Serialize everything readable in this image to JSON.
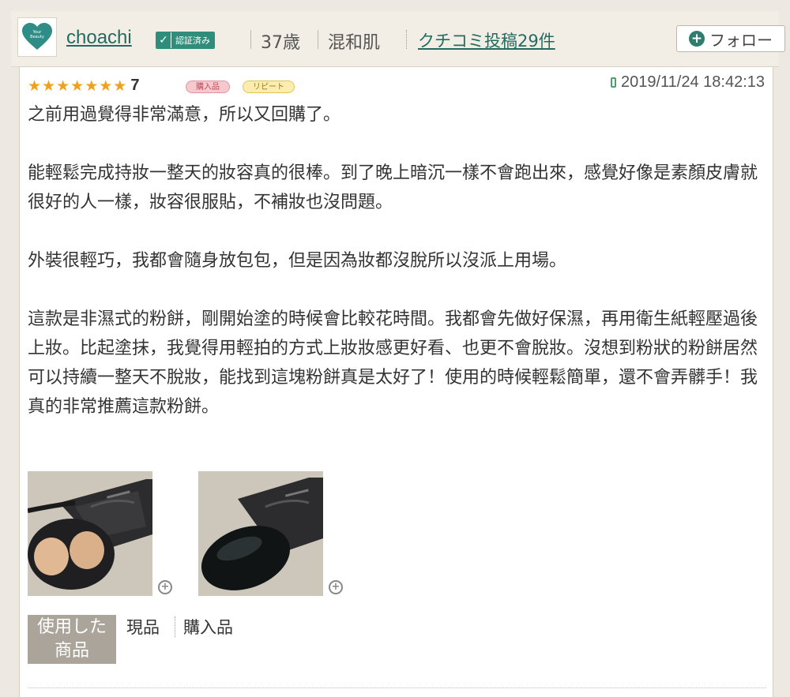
{
  "header": {
    "username": "choachi",
    "verified_label": "認証済み",
    "age": "37歳",
    "skin_type": "混和肌",
    "posts_link": "クチコミ投稿29件",
    "follow_label": "フォロー"
  },
  "review": {
    "rating": "7",
    "stars_filled": 7,
    "tag_purchase": "購入品",
    "tag_repeat": "リピート",
    "timestamp": "2019/11/24 18:42:13",
    "paragraphs": [
      "之前用過覺得非常滿意，所以又回購了。",
      "能輕鬆完成持妝一整天的妝容真的很棒。到了晚上暗沉一樣不會跑出來，感覺好像是素顏皮膚就很好的人一樣，妝容很服貼，不補妝也沒問題。",
      "外裝很輕巧，我都會隨身放包包，但是因為妝都沒脫所以沒派上用場。",
      "這款是非濕式的粉餅，剛開始塗的時候會比較花時間。我都會先做好保濕，再用衛生紙輕壓過後上妝。比起塗抹，我覺得用輕拍的方式上妝妝感更好看、也更不會脫妝。沒想到粉狀的粉餅居然可以持續一整天不脫妝，能找到這塊粉餅真是太好了！使用的時候輕鬆簡單，還不會弄髒手！我真的非常推薦這款粉餅。"
    ],
    "used_label_line1": "使用した",
    "used_label_line2": "商品",
    "used_items": [
      "現品",
      "購入品"
    ]
  },
  "colors": {
    "accent": "#236b60",
    "star": "#f0a01c",
    "background": "#ede9e2"
  }
}
